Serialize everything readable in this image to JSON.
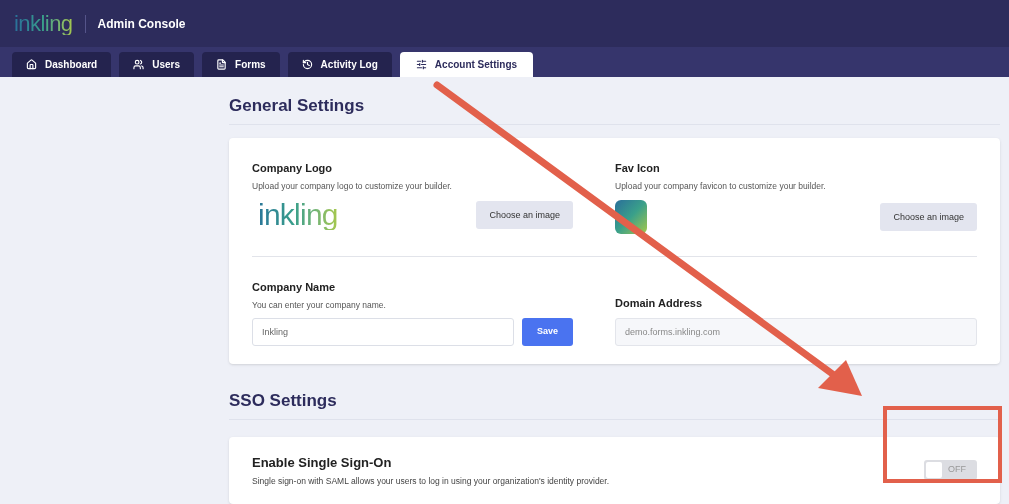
{
  "header": {
    "logo": "inkling",
    "title": "Admin Console"
  },
  "tabs": [
    {
      "label": "Dashboard",
      "selected": false
    },
    {
      "label": "Users",
      "selected": false
    },
    {
      "label": "Forms",
      "selected": false
    },
    {
      "label": "Activity Log",
      "selected": false
    },
    {
      "label": "Account Settings",
      "selected": true
    }
  ],
  "general": {
    "heading": "General Settings",
    "logo": {
      "title": "Company Logo",
      "description": "Upload your company logo to customize your builder.",
      "preview": "inkling",
      "button": "Choose an image"
    },
    "favicon": {
      "title": "Fav Icon",
      "description": "Upload your company favicon to customize your builder.",
      "button": "Choose an image"
    },
    "company_name": {
      "title": "Company Name",
      "description": "You can enter your company name.",
      "value": "Inkling",
      "button": "Save"
    },
    "domain": {
      "title": "Domain Address",
      "value": "demo.forms.inkling.com",
      "disabled": true
    }
  },
  "sso": {
    "heading": "SSO Settings",
    "title": "Enable Single Sign-On",
    "description": "Single sign-on with SAML allows your users to log in using your organization's identity provider.",
    "on": false,
    "reading": "OFF"
  }
}
